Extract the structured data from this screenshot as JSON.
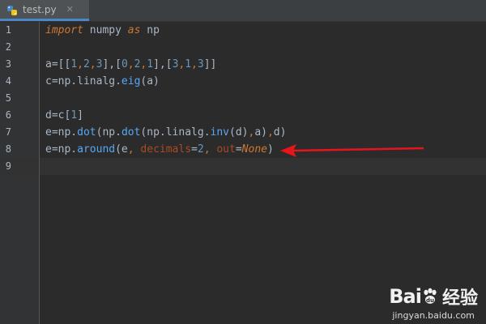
{
  "tab": {
    "label": "test.py",
    "close_glyph": "✕",
    "icon": "python-file-icon"
  },
  "lines": [
    {
      "num": "1",
      "segments": [
        {
          "t": "import",
          "c": "kw"
        },
        {
          "t": " numpy ",
          "c": ""
        },
        {
          "t": "as",
          "c": "kw"
        },
        {
          "t": " np",
          "c": ""
        }
      ]
    },
    {
      "num": "2",
      "segments": []
    },
    {
      "num": "3",
      "segments": [
        {
          "t": "a=[[",
          "c": ""
        },
        {
          "t": "1",
          "c": "num"
        },
        {
          "t": ",",
          "c": "kwn"
        },
        {
          "t": "2",
          "c": "num"
        },
        {
          "t": ",",
          "c": "kwn"
        },
        {
          "t": "3",
          "c": "num"
        },
        {
          "t": "],[",
          "c": ""
        },
        {
          "t": "0",
          "c": "num"
        },
        {
          "t": ",",
          "c": "kwn"
        },
        {
          "t": "2",
          "c": "num"
        },
        {
          "t": ",",
          "c": "kwn"
        },
        {
          "t": "1",
          "c": "num"
        },
        {
          "t": "],[",
          "c": ""
        },
        {
          "t": "3",
          "c": "num"
        },
        {
          "t": ",",
          "c": "kwn"
        },
        {
          "t": "1",
          "c": "num"
        },
        {
          "t": ",",
          "c": "kwn"
        },
        {
          "t": "3",
          "c": "num"
        },
        {
          "t": "]]",
          "c": ""
        }
      ]
    },
    {
      "num": "4",
      "segments": [
        {
          "t": "c=np.linalg.",
          "c": ""
        },
        {
          "t": "eig",
          "c": "fn"
        },
        {
          "t": "(a)",
          "c": ""
        }
      ]
    },
    {
      "num": "5",
      "segments": []
    },
    {
      "num": "6",
      "segments": [
        {
          "t": "d=c[",
          "c": ""
        },
        {
          "t": "1",
          "c": "num"
        },
        {
          "t": "]",
          "c": ""
        }
      ]
    },
    {
      "num": "7",
      "segments": [
        {
          "t": "e=np.",
          "c": ""
        },
        {
          "t": "dot",
          "c": "fn"
        },
        {
          "t": "(np.",
          "c": ""
        },
        {
          "t": "dot",
          "c": "fn"
        },
        {
          "t": "(np.linalg.",
          "c": ""
        },
        {
          "t": "inv",
          "c": "fn"
        },
        {
          "t": "(d)",
          "c": ""
        },
        {
          "t": ",",
          "c": "kwn"
        },
        {
          "t": "a)",
          "c": ""
        },
        {
          "t": ",",
          "c": "kwn"
        },
        {
          "t": "d)",
          "c": ""
        }
      ]
    },
    {
      "num": "8",
      "segments": [
        {
          "t": "e=np.",
          "c": ""
        },
        {
          "t": "around",
          "c": "fn"
        },
        {
          "t": "(e",
          "c": ""
        },
        {
          "t": ", ",
          "c": "kwn"
        },
        {
          "t": "decimals",
          "c": "param"
        },
        {
          "t": "=",
          "c": ""
        },
        {
          "t": "2",
          "c": "num"
        },
        {
          "t": ", ",
          "c": "kwn"
        },
        {
          "t": "out",
          "c": "param"
        },
        {
          "t": "=",
          "c": ""
        },
        {
          "t": "None",
          "c": "none"
        },
        {
          "t": ")",
          "c": ""
        }
      ]
    },
    {
      "num": "9",
      "segments": [],
      "current": true
    }
  ],
  "annotation": {
    "type": "red-arrow",
    "color": "#e8141b",
    "points_to_line": "8"
  },
  "watermark": {
    "brand": "Bai",
    "brand_suffix": "du",
    "cn": "经验",
    "url": "jingyan.baidu.com"
  }
}
